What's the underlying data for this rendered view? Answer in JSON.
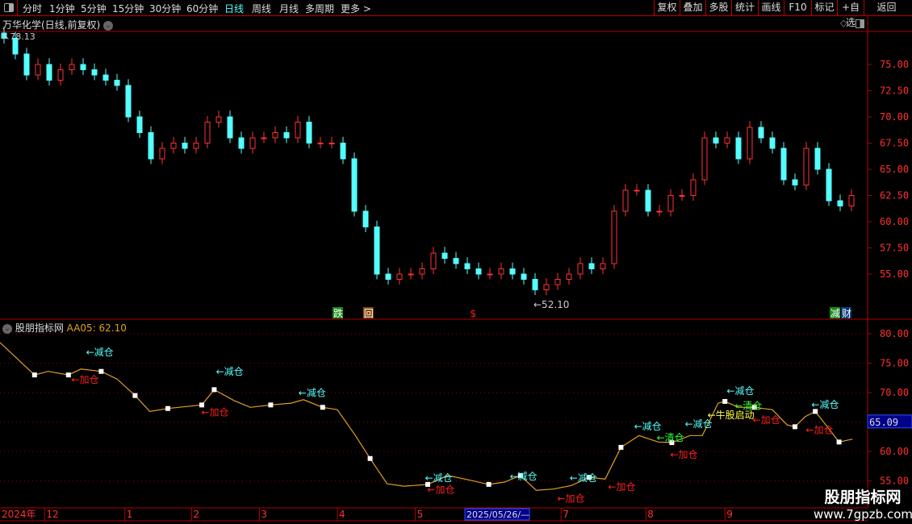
{
  "toolbar": {
    "periods": [
      "分时",
      "1分钟",
      "5分钟",
      "15分钟",
      "30分钟",
      "60分钟",
      "日线",
      "周线",
      "月线",
      "多周期",
      "更多 >"
    ],
    "active": "日线",
    "right_buttons": [
      "复权",
      "叠加",
      "多股",
      "统计",
      "画线",
      "F10",
      "标记",
      "+自选",
      "返回"
    ]
  },
  "chart": {
    "title": "万华化学(日线,前复权)",
    "high_label": "78.13",
    "low_label": "←52.10",
    "price_ticks": [
      "75.00",
      "72.50",
      "70.00",
      "67.50",
      "65.00",
      "62.50",
      "60.00",
      "57.50",
      "55.00"
    ],
    "price_values": [
      75,
      72.5,
      70,
      67.5,
      65,
      62.5,
      60,
      57.5,
      55
    ],
    "closes": [
      77.5,
      76,
      74,
      75,
      73.5,
      74.5,
      75,
      74.5,
      74,
      73.5,
      73,
      70,
      68.5,
      66,
      67,
      67.5,
      67,
      67.5,
      69.5,
      70,
      68,
      67,
      68,
      68,
      68.5,
      68,
      69.5,
      67.5,
      67.5,
      67.5,
      66,
      61,
      59.5,
      55,
      54.5,
      55,
      55,
      55.5,
      57,
      56.5,
      56,
      55.5,
      55,
      55,
      55.5,
      55,
      54.5,
      53.5,
      54,
      54.5,
      55,
      56,
      55.5,
      56,
      61,
      63,
      63,
      61,
      61,
      62.5,
      62.5,
      64,
      68,
      67.5,
      68,
      66,
      69,
      68,
      67,
      64,
      63.5,
      67,
      65,
      62,
      61.5,
      62.5
    ],
    "signals": [
      {
        "text": "跌",
        "bg": "#1a8a1a",
        "bar": 29.5
      },
      {
        "text": "回",
        "bg": "#8a4a10",
        "bar": 32.2
      },
      {
        "text": "$",
        "bg": "",
        "bar": 41.6
      },
      {
        "text": "减",
        "bg": "#1a8a1a",
        "bar": 73.5
      },
      {
        "text": "财",
        "bg": "#0a3a7a",
        "bar": 74.5
      }
    ],
    "colors": {
      "up": "#ff3232",
      "down": "#54ffff",
      "grid": "#b00000"
    }
  },
  "indicator": {
    "name": "股朋指标网",
    "value_label": "AA05: 62.10",
    "current_value": "65.09",
    "ticks": [
      "80.00",
      "75.00",
      "70.00",
      "65.00",
      "60.00",
      "55.00"
    ],
    "tick_values": [
      80,
      75,
      70,
      65,
      60,
      55
    ],
    "line": [
      [
        -0.36,
        78.5
      ],
      [
        2.7,
        73
      ],
      [
        3.9,
        73.6
      ],
      [
        5.7,
        73
      ],
      [
        6.8,
        74
      ],
      [
        8.6,
        73.6
      ],
      [
        10,
        72.3
      ],
      [
        11.6,
        69.5
      ],
      [
        12.9,
        66.8
      ],
      [
        14.5,
        67.3
      ],
      [
        17.5,
        67.9
      ],
      [
        18.6,
        70.5
      ],
      [
        20.4,
        68.6
      ],
      [
        21.8,
        67.5
      ],
      [
        23.6,
        67.9
      ],
      [
        25.4,
        68.2
      ],
      [
        26.5,
        68.8
      ],
      [
        28.2,
        67.5
      ],
      [
        29.5,
        67.1
      ],
      [
        31.1,
        62.7
      ],
      [
        32.4,
        58.8
      ],
      [
        33.9,
        54.5
      ],
      [
        35.4,
        54.1
      ],
      [
        37.5,
        54.4
      ],
      [
        39.3,
        55.9
      ],
      [
        41.3,
        55.1
      ],
      [
        42.9,
        54.4
      ],
      [
        44.3,
        54.8
      ],
      [
        45.7,
        55.9
      ],
      [
        47.1,
        53.4
      ],
      [
        48.6,
        53.6
      ],
      [
        50.2,
        54.2
      ],
      [
        51.8,
        55.6
      ],
      [
        53.2,
        55.3
      ],
      [
        54.6,
        60.7
      ],
      [
        56.2,
        62.7
      ],
      [
        57.9,
        61.6
      ],
      [
        59.1,
        61.5
      ],
      [
        60.7,
        62.7
      ],
      [
        61.8,
        62.7
      ],
      [
        63.2,
        68.2
      ],
      [
        63.8,
        68.5
      ],
      [
        65,
        67.5
      ],
      [
        66.4,
        67.5
      ],
      [
        68,
        67.1
      ],
      [
        69.3,
        64.5
      ],
      [
        70,
        64.2
      ],
      [
        70.9,
        65.9
      ],
      [
        71.8,
        66.8
      ],
      [
        72.9,
        64.1
      ],
      [
        73.9,
        61.6
      ],
      [
        75.1,
        62.1
      ]
    ],
    "markers": [
      1,
      3,
      5,
      7,
      9,
      10,
      11,
      14,
      17,
      20,
      23,
      26,
      28,
      32,
      34,
      37,
      41,
      43,
      46,
      48,
      50,
      53,
      56,
      59,
      61,
      64,
      67,
      69,
      70,
      71,
      73
    ],
    "labels": [
      {
        "text": "←减仓",
        "color": "#54ffff",
        "bar": 7.4,
        "value": 77.0
      },
      {
        "text": "←减仓",
        "color": "#54ffff",
        "bar": 18.9,
        "value": 73.7
      },
      {
        "text": "←减仓",
        "color": "#54ffff",
        "bar": 26.2,
        "value": 70.1
      },
      {
        "text": "←减仓",
        "color": "#54ffff",
        "bar": 37.4,
        "value": 55.6
      },
      {
        "text": "←减仓",
        "color": "#54ffff",
        "bar": 44.9,
        "value": 55.9
      },
      {
        "text": "←减仓",
        "color": "#54ffff",
        "bar": 50.2,
        "value": 55.6
      },
      {
        "text": "←减仓",
        "color": "#54ffff",
        "bar": 55.9,
        "value": 64.4
      },
      {
        "text": "←减仓",
        "color": "#54ffff",
        "bar": 60.4,
        "value": 64.8
      },
      {
        "text": "←减仓",
        "color": "#54ffff",
        "bar": 64.1,
        "value": 70.4
      },
      {
        "text": "←减仓",
        "color": "#54ffff",
        "bar": 71.6,
        "value": 68.1
      },
      {
        "text": "←加仓",
        "color": "#ff2020",
        "bar": 6.1,
        "value": 72.3
      },
      {
        "text": "←加仓",
        "color": "#ff2020",
        "bar": 17.6,
        "value": 66.8
      },
      {
        "text": "←加仓",
        "color": "#ff2020",
        "bar": 37.6,
        "value": 53.6
      },
      {
        "text": "←加仓",
        "color": "#ff2020",
        "bar": 49.1,
        "value": 52.1
      },
      {
        "text": "←加仓",
        "color": "#ff2020",
        "bar": 53.6,
        "value": 54.1
      },
      {
        "text": "←加仓",
        "color": "#ff2020",
        "bar": 59.1,
        "value": 59.6
      },
      {
        "text": "←加仓",
        "color": "#ff2020",
        "bar": 66.4,
        "value": 65.5
      },
      {
        "text": "←加仓",
        "color": "#ff2020",
        "bar": 71.1,
        "value": 63.8
      },
      {
        "text": "←清仓",
        "color": "#30ff30",
        "bar": 57.9,
        "value": 62.5
      },
      {
        "text": "←清仓",
        "color": "#30ff30",
        "bar": 64.8,
        "value": 67.9
      },
      {
        "text": "←牛股启动",
        "color": "#ffff40",
        "bar": 62.4,
        "value": 66.3
      }
    ],
    "line_color": "#e0a020"
  },
  "xaxis": {
    "year": "2024年",
    "months": [
      {
        "label": "12",
        "bar": 3.6
      },
      {
        "label": "1",
        "bar": 10.7
      },
      {
        "label": "2",
        "bar": 16.6
      },
      {
        "label": "3",
        "bar": 22.6
      },
      {
        "label": "4",
        "bar": 29.5
      },
      {
        "label": "5",
        "bar": 36.4
      },
      {
        "label": "7",
        "bar": 49.3
      },
      {
        "label": "8",
        "bar": 56.8
      },
      {
        "label": "9",
        "bar": 63.8
      }
    ],
    "cursor_date": "2025/05/26/—"
  },
  "watermark": {
    "name": "股朋指标网",
    "url": "www.7gpzb.com"
  }
}
